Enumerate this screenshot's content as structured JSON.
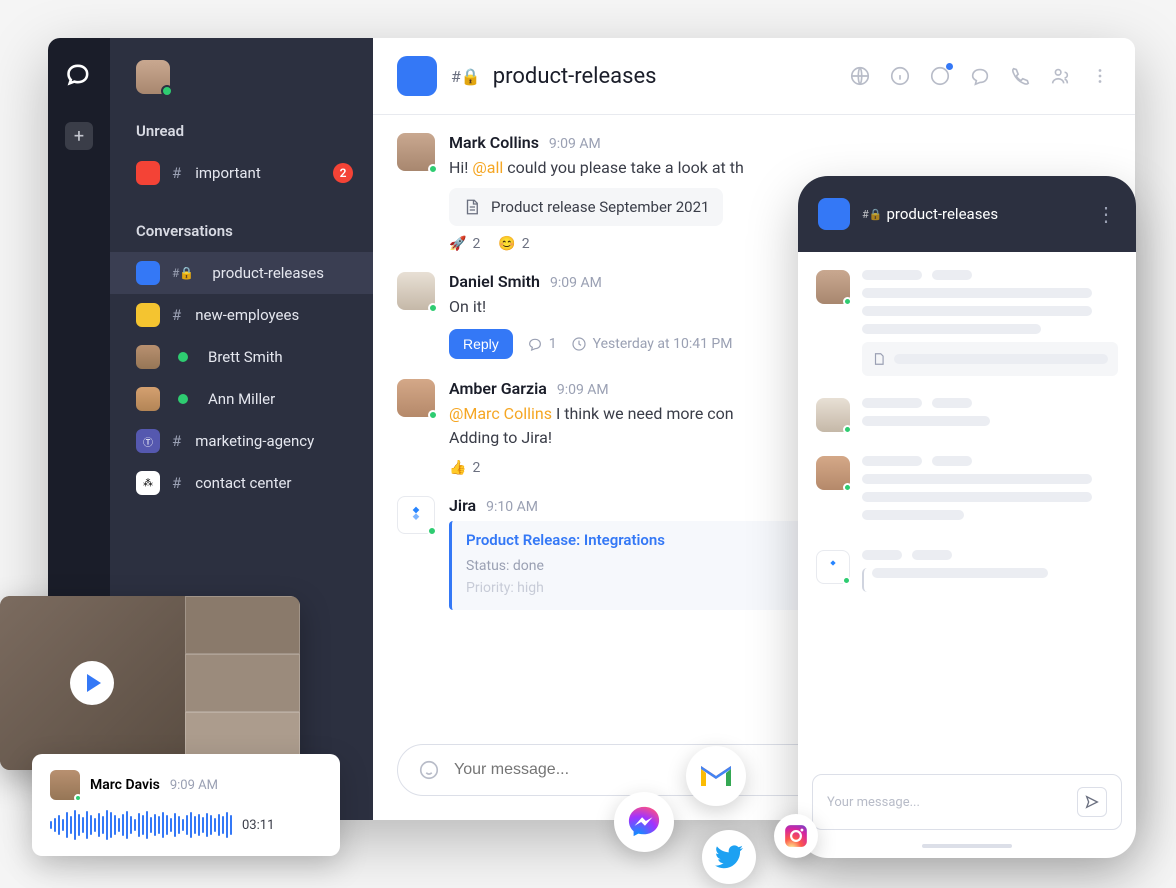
{
  "sidebar": {
    "section_unread": "Unread",
    "unread_channel": {
      "name": "important",
      "badge": "2"
    },
    "section_convos": "Conversations",
    "items": [
      {
        "name": "product-releases",
        "kind": "channel-locked"
      },
      {
        "name": "new-employees",
        "kind": "channel"
      },
      {
        "name": "Brett Smith",
        "kind": "dm"
      },
      {
        "name": "Ann Miller",
        "kind": "dm"
      },
      {
        "name": "marketing-agency",
        "kind": "teams"
      },
      {
        "name": "contact center",
        "kind": "slack"
      }
    ]
  },
  "header": {
    "channel": "product-releases"
  },
  "messages": [
    {
      "author": "Mark Collins",
      "time": "9:09 AM",
      "text_pre": "Hi! ",
      "mention": "@all",
      "text_post": " could you please take a look at th",
      "attachment": "Product release September 2021",
      "reactions": [
        {
          "emoji": "🚀",
          "count": "2"
        },
        {
          "emoji": "😊",
          "count": "2"
        }
      ]
    },
    {
      "author": "Daniel Smith",
      "time": "9:09 AM",
      "text": "On it!",
      "reply_label": "Reply",
      "reply_count": "1",
      "reply_time": "Yesterday at 10:41 PM"
    },
    {
      "author": "Amber Garzia",
      "time": "9:09 AM",
      "mention": "@Marc Collins",
      "text_post": " I think we need more con",
      "text_line2": "Adding to Jira!",
      "reactions": [
        {
          "emoji": "👍",
          "count": "2"
        }
      ]
    },
    {
      "author": "Jira",
      "time": "9:10 AM",
      "card_title": "Product Release: Integrations",
      "card_status": "Status: done",
      "card_priority": "Priority: high"
    }
  ],
  "composer": {
    "placeholder": "Your message..."
  },
  "mobile": {
    "channel": "product-releases",
    "composer_placeholder": "Your message..."
  },
  "voice": {
    "author": "Marc Davis",
    "time": "9:09 AM",
    "duration": "03:11"
  }
}
